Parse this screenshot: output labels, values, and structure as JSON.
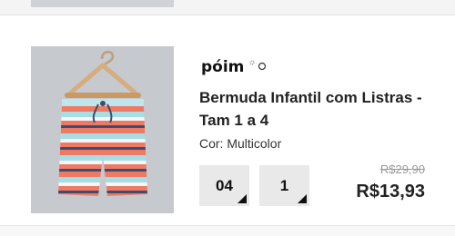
{
  "product": {
    "brand": "póim",
    "title": "Bermuda Infantil com Listras - Tam 1 a 4",
    "color_label": "Cor: Multicolor",
    "size": "04",
    "quantity": "1",
    "old_price": "R$29,90",
    "price": "R$13,93",
    "image_subject": "striped-shorts-on-hanger"
  },
  "colors": {
    "image_bg": "#c6c9ce",
    "stripe_light_blue": "#a9dde4",
    "stripe_coral": "#ee7a66",
    "stripe_navy": "#3f4d6b",
    "select_bg": "#e9e9e9"
  }
}
